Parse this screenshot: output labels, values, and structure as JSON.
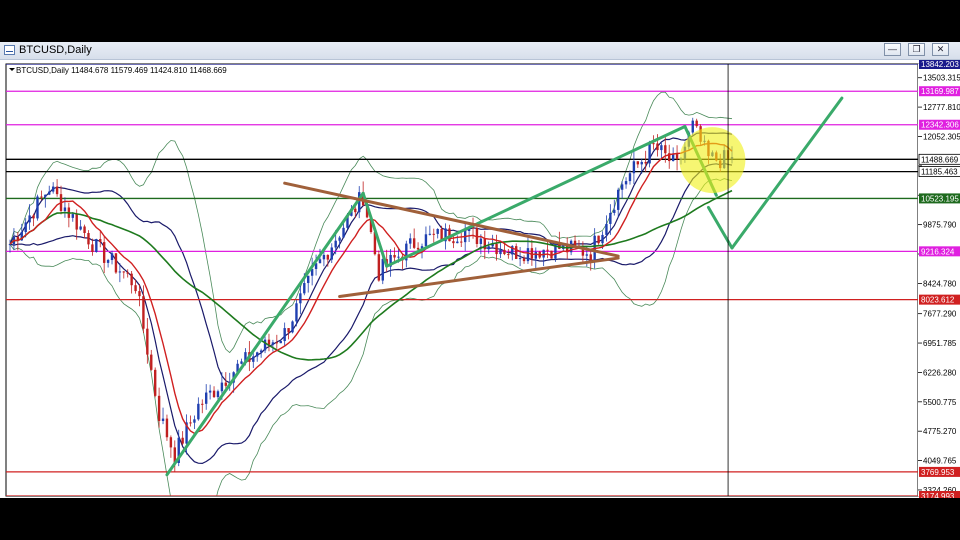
{
  "window": {
    "title": "BTCUSD,Daily",
    "controls": [
      "minimize-icon",
      "restore-icon",
      "close-icon"
    ]
  },
  "chart_data": {
    "type": "candlestick",
    "title": "BTCUSD,Daily  11484.678 11579.469 11424.810 11468.669",
    "ylim": [
      3174.993,
      13842.203
    ],
    "y_ticks": [
      13503.315,
      12777.81,
      12052.305,
      11326.8,
      10601.295,
      9875.79,
      9150.285,
      8424.78,
      7677.29,
      6951.785,
      6226.28,
      5500.775,
      4775.27,
      4049.765,
      3324.26
    ],
    "y_tick_labels": [
      "13503.315",
      "12777.810",
      "12052.305",
      "",
      "",
      "9875.790",
      "",
      "8424.780",
      "7677.290",
      "6951.785",
      "6226.280",
      "5500.775",
      "4775.270",
      "4049.765",
      "3324.260"
    ],
    "price_levels": [
      {
        "label": "13842.203",
        "value": 13842.203,
        "color": "#1a1a8c"
      },
      {
        "label": "13169.987",
        "value": 13169.987,
        "color": "#e020e0"
      },
      {
        "label": "12342.306",
        "value": 12342.306,
        "color": "#e020e0"
      },
      {
        "label": "11488.669",
        "value": 11488.669,
        "color": "#000000"
      },
      {
        "label": "11185.463",
        "value": 11185.463,
        "color": "#000000"
      },
      {
        "label": "10523.195",
        "value": 10523.195,
        "color": "#1e6a1e"
      },
      {
        "label": "9216.324",
        "value": 9216.324,
        "color": "#e020e0"
      },
      {
        "label": "8023.612",
        "value": 8023.612,
        "color": "#d02020"
      },
      {
        "label": "3769.953",
        "value": 3769.953,
        "color": "#d02020"
      },
      {
        "label": "3174.993",
        "value": 3174.993,
        "color": "#d02020"
      }
    ],
    "key_points": [
      {
        "t": 0,
        "price": 9400
      },
      {
        "t": 10,
        "price": 10800
      },
      {
        "t": 22,
        "price": 9300
      },
      {
        "t": 32,
        "price": 8400
      },
      {
        "t": 38,
        "price": 5200
      },
      {
        "t": 42,
        "price": 4200
      },
      {
        "t": 48,
        "price": 5400
      },
      {
        "t": 56,
        "price": 6200
      },
      {
        "t": 64,
        "price": 6800
      },
      {
        "t": 70,
        "price": 7200
      },
      {
        "t": 78,
        "price": 8800
      },
      {
        "t": 90,
        "price": 10600
      },
      {
        "t": 94,
        "price": 8700
      },
      {
        "t": 104,
        "price": 9500
      },
      {
        "t": 116,
        "price": 9700
      },
      {
        "t": 128,
        "price": 9200
      },
      {
        "t": 140,
        "price": 9300
      },
      {
        "t": 148,
        "price": 9200
      },
      {
        "t": 156,
        "price": 10900
      },
      {
        "t": 164,
        "price": 11800
      },
      {
        "t": 170,
        "price": 11300
      },
      {
        "t": 174,
        "price": 12300
      },
      {
        "t": 178,
        "price": 11500
      },
      {
        "t": 184,
        "price": 11468
      }
    ],
    "n_bars": 185,
    "seed": 7
  }
}
